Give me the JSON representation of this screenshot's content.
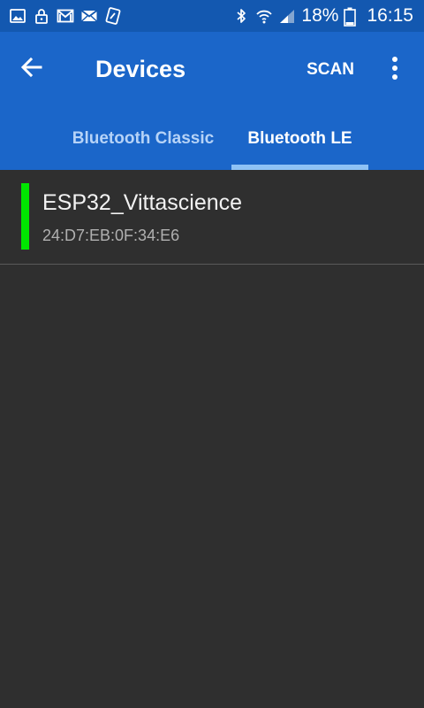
{
  "status_bar": {
    "battery_percent": "18%",
    "time": "16:15",
    "left_icons": [
      "image-icon",
      "lock-icon",
      "gmail-icon",
      "mail-icon",
      "data-saver-icon"
    ],
    "right_icons": [
      "bluetooth-icon",
      "wifi-icon",
      "cell-signal-icon",
      "battery-icon"
    ]
  },
  "app_bar": {
    "title": "Devices",
    "scan_label": "SCAN",
    "back_icon": "arrow-left-icon",
    "overflow_icon": "more-vert-icon",
    "color": "#1b66c9"
  },
  "tabs": [
    {
      "label": "Bluetooth Classic",
      "selected": false
    },
    {
      "label": "Bluetooth LE",
      "selected": true
    }
  ],
  "devices": [
    {
      "name": "ESP32_Vittascience",
      "address": "24:D7:EB:0F:34:E6",
      "signal_color": "#00e600"
    }
  ],
  "colors": {
    "status_bar": "#1358b0",
    "accent": "#1b66c9",
    "tab_indicator": "#8ec2f5",
    "background": "#2f2f2f"
  }
}
